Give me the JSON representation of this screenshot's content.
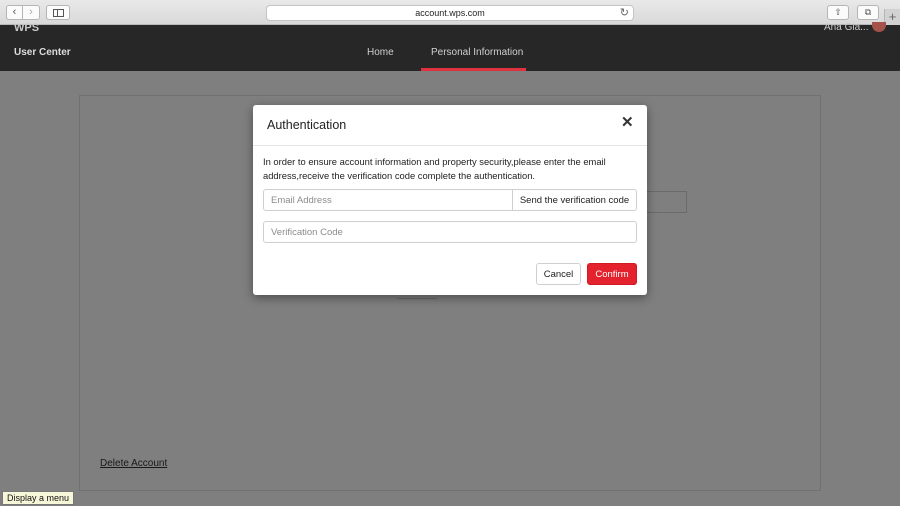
{
  "browser": {
    "url": "account.wps.com",
    "back_icon": "chevron-left-icon",
    "forward_icon": "chevron-right-icon",
    "reload_icon": "reload-icon",
    "back_glyph": "‹",
    "forward_glyph": "›",
    "reload_glyph": "↻",
    "share_glyph": "⇧",
    "tabs_glyph": "⧉",
    "newtab_glyph": "+"
  },
  "site": {
    "logo_text": "WPS",
    "section_title": "User Center",
    "nav": [
      {
        "label": "Home",
        "active": false
      },
      {
        "label": "Personal Information",
        "active": true
      }
    ],
    "username": "Ana Gia...",
    "accent_color": "#e0313e"
  },
  "page": {
    "delete_account_label": "Delete Account"
  },
  "modal": {
    "title": "Authentication",
    "close_glyph": "✕",
    "description": "In order to ensure account information and property security,please enter the email address,receive the verification code complete the authentication.",
    "email": {
      "value": "",
      "placeholder": "Email Address"
    },
    "send_code_label": "Send the verification code",
    "code": {
      "value": "",
      "placeholder": "Verification Code"
    },
    "cancel_label": "Cancel",
    "confirm_label": "Confirm",
    "confirm_color": "#e3222d"
  },
  "tooltip": {
    "text": "Display a menu"
  }
}
